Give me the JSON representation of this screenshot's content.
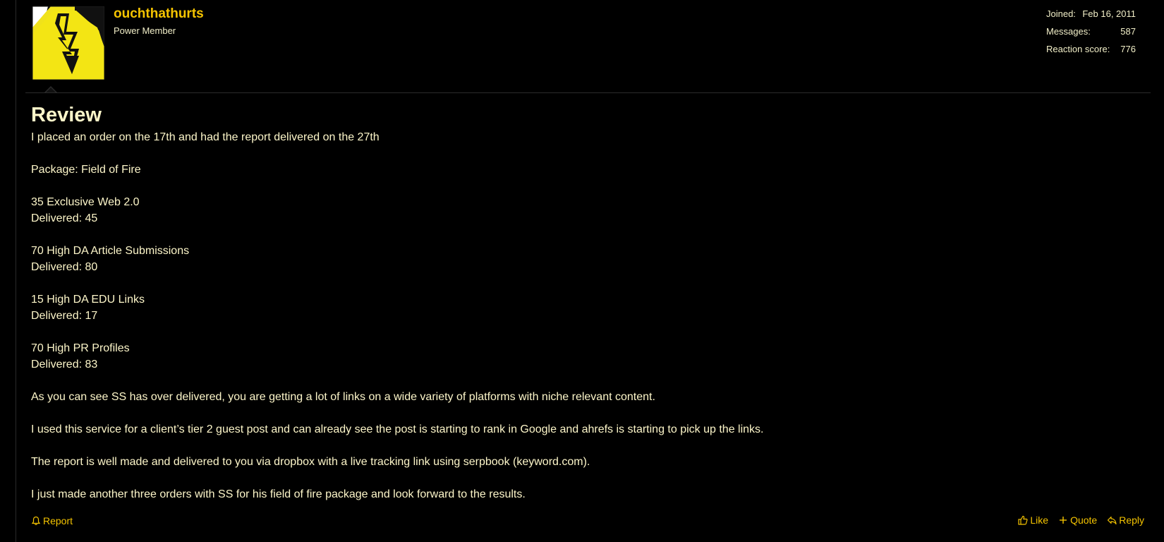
{
  "user": {
    "name": "ouchthathurts",
    "title": "Power Member"
  },
  "stats": [
    {
      "label": "Joined:",
      "value": "Feb 16, 2011"
    },
    {
      "label": "Messages:",
      "value": "587"
    },
    {
      "label": "Reaction score:",
      "value": "776"
    }
  ],
  "post": {
    "title": "Review",
    "lines": [
      "I placed an order on the 17th and had the report delivered on the 27th",
      "",
      "Package: Field of Fire",
      "",
      "35 Exclusive Web 2.0",
      "Delivered: 45",
      "",
      "70 High DA Article Submissions",
      "Delivered: 80",
      "",
      "15 High DA EDU Links",
      "Delivered: 17",
      "",
      "70 High PR Profiles",
      "Delivered: 83",
      "",
      "As you can see SS has over delivered, you are getting a lot of links on a wide variety of platforms with niche relevant content.",
      "",
      "I used this service for a client’s tier 2 guest post and can already see the post is starting to rank in Google and ahrefs is starting to pick up the links.",
      "",
      "The report is well made and delivered to you via dropbox with a live tracking link using serpbook (keyword.com).",
      "",
      "I just made another three orders with SS for his field of fire package and look forward to the results."
    ]
  },
  "footer": {
    "report_label": "Report",
    "like_label": "Like",
    "quote_label": "Quote",
    "reply_label": "Reply"
  },
  "colors": {
    "background": "#000000",
    "accent": "#f5c400",
    "text": "#fdf6c9"
  },
  "icons": {
    "avatar": "high-voltage-sign",
    "report": "bell-icon",
    "like": "thumbs-up-icon",
    "quote": "plus-icon",
    "reply": "reply-icon"
  }
}
